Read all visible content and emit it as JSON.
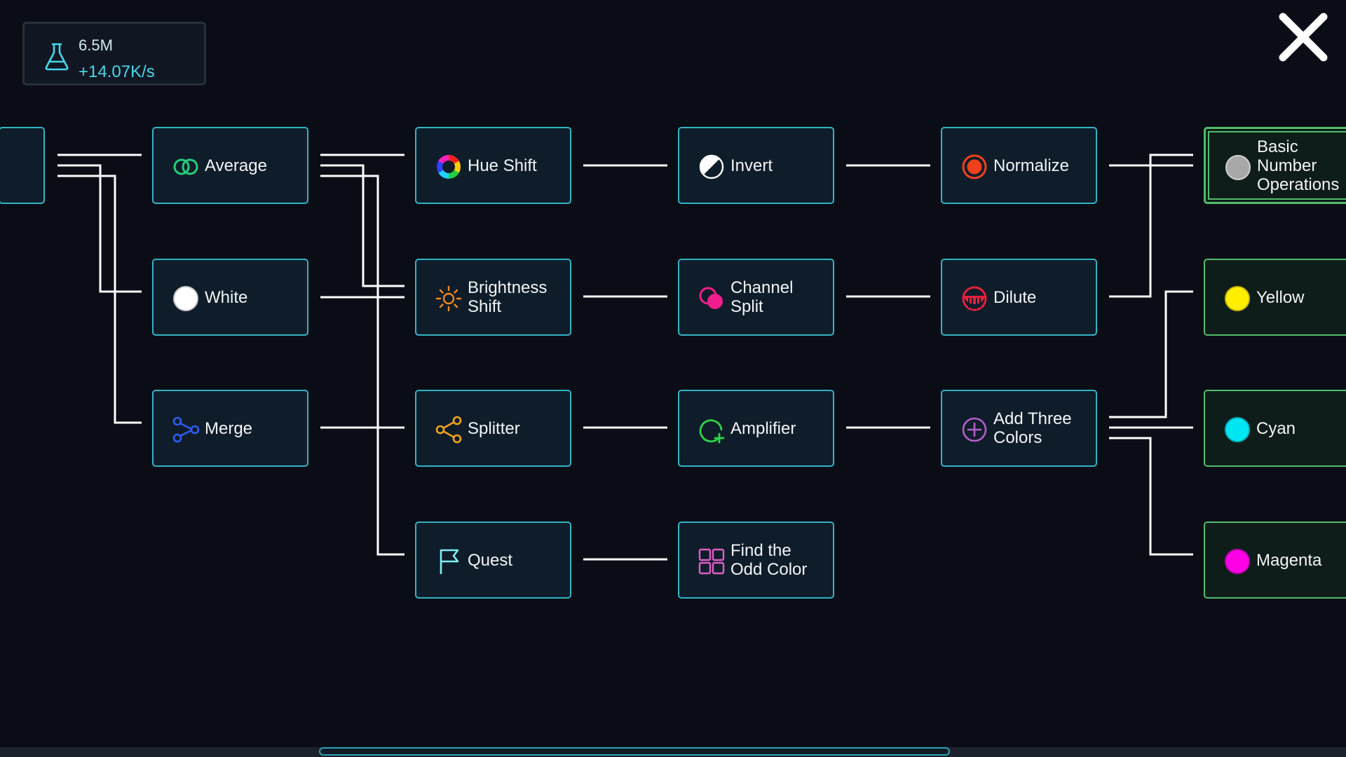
{
  "resource": {
    "icon": "flask-icon",
    "amount": "6.5M",
    "rate": "+14.07K/s",
    "rate_color": "#45d6ea"
  },
  "close": {
    "icon": "close-icon"
  },
  "nodes": {
    "average": {
      "label": "Average",
      "icon": "two-rings-icon",
      "color": "#22cf7a"
    },
    "white": {
      "label": "White",
      "icon": "white-dot-icon",
      "color": "#ffffff"
    },
    "merge": {
      "label": "Merge",
      "icon": "merge-icon",
      "color": "#2f5bf2"
    },
    "hue_shift": {
      "label": "Hue Shift",
      "icon": "color-wheel-icon",
      "color": "#ff3cb4"
    },
    "brightness_shift": {
      "label": "Brightness\nShift",
      "icon": "sun-icon",
      "color": "#f28a1c"
    },
    "splitter": {
      "label": "Splitter",
      "icon": "share-icon",
      "color": "#f2a21c"
    },
    "quest": {
      "label": "Quest",
      "icon": "flag-icon",
      "color": "#7ef0f2"
    },
    "invert": {
      "label": "Invert",
      "icon": "invert-icon",
      "color": "#ffffff"
    },
    "channel_split": {
      "label": "Channel\nSplit",
      "icon": "channel-split-icon",
      "color": "#f01e8c"
    },
    "amplifier": {
      "label": "Amplifier",
      "icon": "amplifier-icon",
      "color": "#2cd44a"
    },
    "find_odd_color": {
      "label": "Find the\nOdd Color",
      "icon": "grid-icon",
      "color": "#e05ec8"
    },
    "normalize": {
      "label": "Normalize",
      "icon": "target-icon",
      "color": "#f0401c"
    },
    "dilute": {
      "label": "Dilute",
      "icon": "dilute-icon",
      "color": "#e81e3c"
    },
    "add_three_colors": {
      "label": "Add Three\nColors",
      "icon": "plus-circle-icon",
      "color": "#b45ec8"
    },
    "basic_number_operations": {
      "label": "Basic\nNumber\nOperations",
      "icon": "gray-dot-icon",
      "color": "#a8a8a8"
    },
    "yellow": {
      "label": "Yellow",
      "icon": "yellow-dot-icon",
      "color": "#ffee00"
    },
    "cyan": {
      "label": "Cyan",
      "icon": "cyan-dot-icon",
      "color": "#00e6f2"
    },
    "magenta": {
      "label": "Magenta",
      "icon": "magenta-dot-icon",
      "color": "#ff00e6"
    }
  },
  "colors": {
    "background": "#0b0d16",
    "node_fill": "#0f1d2a",
    "node_border": "#31b3c6",
    "output_border": "#52bb6a",
    "wire": "#ffffff"
  }
}
